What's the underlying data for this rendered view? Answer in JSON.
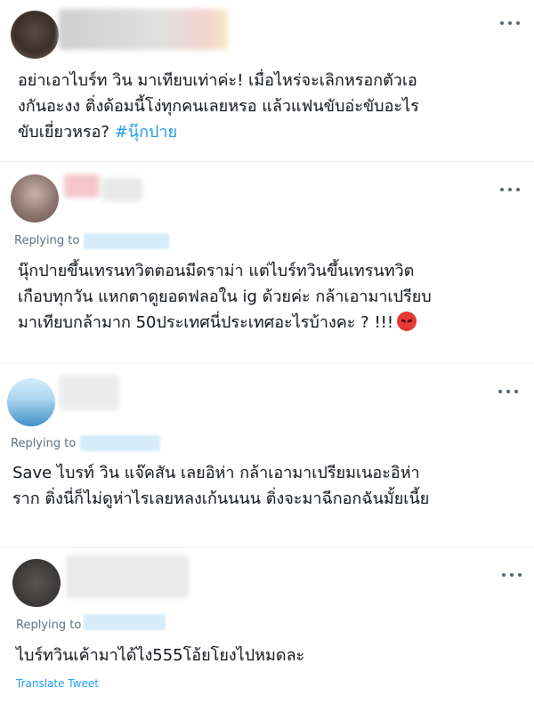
{
  "tweets": [
    {
      "lines": [
        "อย่าเอาไบร์ท วิน มาเทียบเท่าค่ะ! เมื่อไหร่จะเลิกหรอกตัวเอ",
        "งกันอะงง ติ่งด้อมนี้โง่ทุกคนเลยหรอ แล้วแฟนขับอ่ะขับอะไร",
        "ขับเยี่ยวหรอ? "
      ],
      "hashtag": "#นุ๊กปาย"
    },
    {
      "replying_label": "Replying to",
      "lines": [
        "นุ๊กปายขึ้นเทรนทวิตตอนมีดราม่า แต่ไบร์ทวินขึ้นเทรนทวิต",
        "เกือบทุกวัน แหกตาดูยอดฟลอใน ig ด้วยค่ะ กล้าเอามาเปรียบ",
        "มาเทียบกล้ามาก 50ประเทศนี่ประเทศอะไรบ้างคะ ? !!!"
      ],
      "emoji": "angry-face"
    },
    {
      "replying_label": "Replying to",
      "lines": [
        "Save ไบรท์ วิน แจ๊คสัน เลยอิห่า กล้าเอามาเปรียมเนอะอิห่า",
        "ราก ติ่งนี่ก็ไม่ดูห่าไรเลยหลงเก้นนนน ติ่งจะมาฉีกอกฉันมั้ยเนี้ย"
      ]
    },
    {
      "replying_label": "Replying to",
      "lines": [
        "ไบร์ทวินเค้ามาได้ไง555โอ้ยโยงไปหมดละ"
      ],
      "translate_label": "Translate Tweet"
    }
  ],
  "colors": {
    "link": "#1d9bf0",
    "muted": "#5b7083",
    "text": "#0f1419",
    "divider": "#e6ecf0"
  },
  "icons": [
    "more-options-icon",
    "angry-face-emoji"
  ]
}
